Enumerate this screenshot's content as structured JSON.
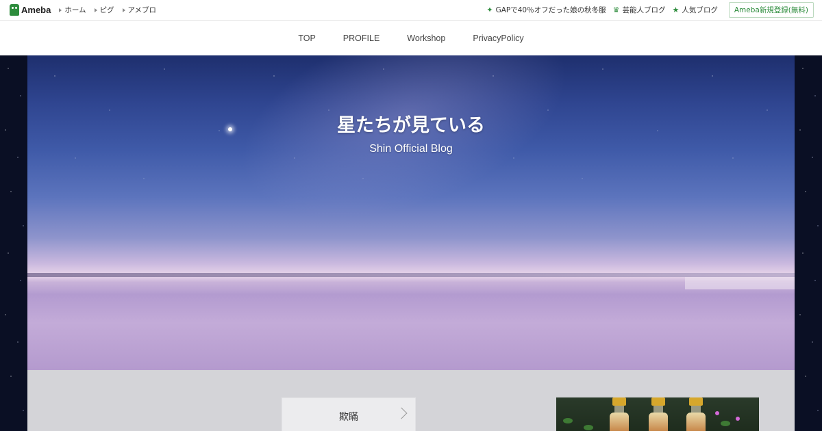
{
  "topbar": {
    "logo": "Ameba",
    "nav": [
      "ホーム",
      "ピグ",
      "アメブロ"
    ],
    "promos": [
      {
        "icon": "sparkle-icon",
        "label": "GAPで40％オフだった娘の秋冬服"
      },
      {
        "icon": "crown-icon",
        "label": "芸能人ブログ"
      },
      {
        "icon": "star-icon",
        "label": "人気ブログ"
      }
    ],
    "signup": "Ameba新規登録(無料)"
  },
  "blognav": [
    "TOP",
    "PROFILE",
    "Workshop",
    "PrivacyPolicy"
  ],
  "hero": {
    "title": "星たちが見ている",
    "subtitle": "Shin Official Blog"
  },
  "entry": {
    "label": "欺瞞"
  },
  "colors": {
    "ameba_green": "#2d8c3c",
    "content_bg": "#d4d4d8"
  }
}
